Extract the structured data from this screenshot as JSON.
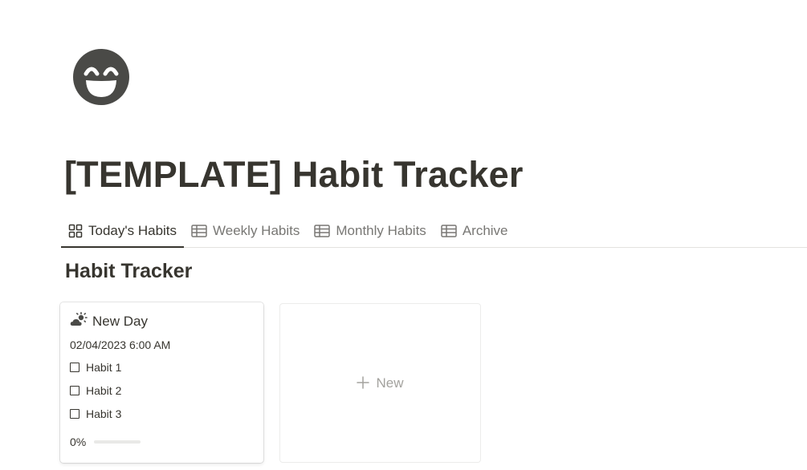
{
  "page": {
    "icon": "grinning-face-icon",
    "title": "[TEMPLATE] Habit Tracker"
  },
  "tabs": [
    {
      "label": "Today's Habits",
      "icon": "gallery-icon",
      "active": true
    },
    {
      "label": "Weekly Habits",
      "icon": "table-icon",
      "active": false
    },
    {
      "label": "Monthly Habits",
      "icon": "table-icon",
      "active": false
    },
    {
      "label": "Archive",
      "icon": "table-icon",
      "active": false
    }
  ],
  "section": {
    "title": "Habit Tracker"
  },
  "cards": [
    {
      "icon": "sun-behind-cloud-icon",
      "title": "New Day",
      "date": "02/04/2023 6:00 AM",
      "habits": [
        {
          "label": "Habit 1",
          "checked": false
        },
        {
          "label": "Habit 2",
          "checked": false
        },
        {
          "label": "Habit 3",
          "checked": false
        }
      ],
      "progress_label": "0%",
      "progress_value": 0
    }
  ],
  "new_card": {
    "label": "New",
    "icon": "plus-icon"
  },
  "colors": {
    "text": "#37352f",
    "muted": "#787774",
    "placeholder": "#a3a29e",
    "border": "#e3e2e0",
    "icon_fill": "#4a4a47"
  }
}
